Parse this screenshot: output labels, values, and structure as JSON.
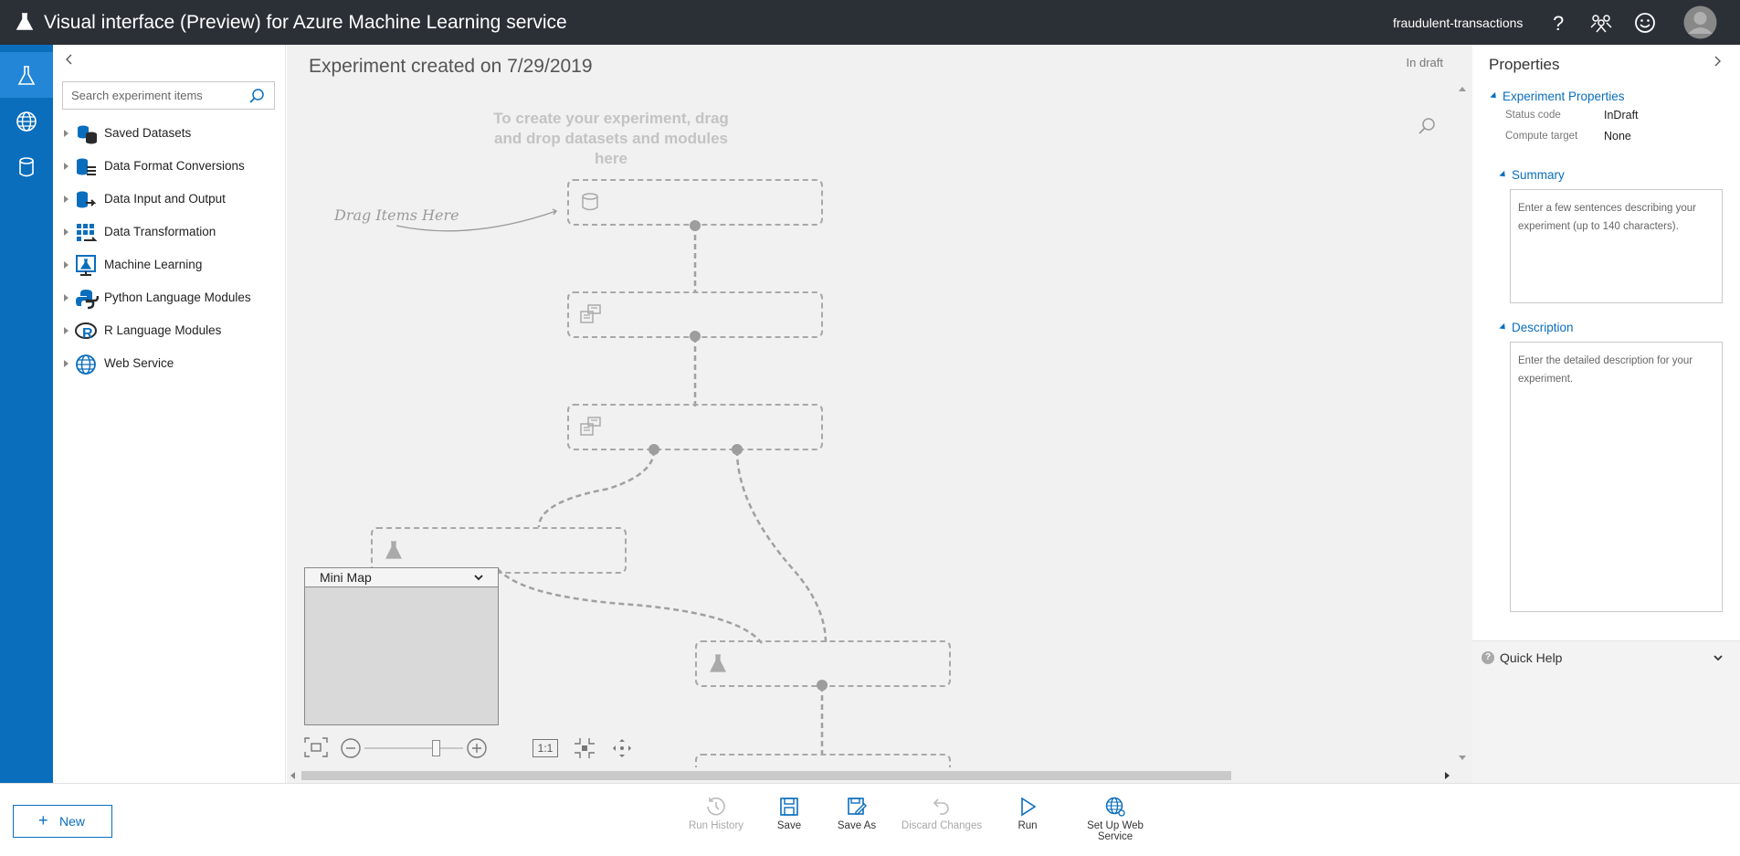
{
  "topbar": {
    "title": "Visual interface (Preview) for Azure Machine Learning service",
    "workspace": "fraudulent-transactions",
    "icons": [
      "flask-logo-icon",
      "help-icon",
      "community-icon",
      "feedback-smiley-icon",
      "user-avatar-icon"
    ]
  },
  "leftnav": {
    "items": [
      {
        "name": "experiments",
        "icon": "flask-icon",
        "active": true
      },
      {
        "name": "web-services",
        "icon": "globe-icon",
        "active": false
      },
      {
        "name": "datasets",
        "icon": "database-icon",
        "active": false
      }
    ]
  },
  "palette": {
    "search_placeholder": "Search experiment items",
    "categories": [
      {
        "label": "Saved Datasets",
        "icon": "dataset-icon"
      },
      {
        "label": "Data Format Conversions",
        "icon": "conversion-icon"
      },
      {
        "label": "Data Input and Output",
        "icon": "io-icon"
      },
      {
        "label": "Data Transformation",
        "icon": "transform-icon"
      },
      {
        "label": "Machine Learning",
        "icon": "ml-icon"
      },
      {
        "label": "Python Language Modules",
        "icon": "python-icon"
      },
      {
        "label": "R Language Modules",
        "icon": "r-icon"
      },
      {
        "label": "Web Service",
        "icon": "globe-icon"
      }
    ]
  },
  "canvas": {
    "experiment_title": "Experiment created on 7/29/2019",
    "status": "In draft",
    "hint": "To create your experiment, drag and drop datasets and modules here",
    "drag_label": "Drag Items Here",
    "minimap_label": "Mini Map",
    "zoom_reset_label": "1:1"
  },
  "properties": {
    "title": "Properties",
    "experiment_properties_label": "Experiment Properties",
    "status_code_label": "Status code",
    "status_code_value": "InDraft",
    "compute_target_label": "Compute target",
    "compute_target_value": "None",
    "summary_label": "Summary",
    "summary_placeholder": "Enter a few sentences describing your experiment (up to 140 characters).",
    "description_label": "Description",
    "description_placeholder": "Enter the detailed description for your experiment.",
    "quick_help_label": "Quick Help"
  },
  "bottombar": {
    "new_label": "New",
    "actions": [
      {
        "label": "Run History",
        "enabled": false,
        "icon": "history-icon"
      },
      {
        "label": "Save",
        "enabled": true,
        "icon": "save-icon"
      },
      {
        "label": "Save As",
        "enabled": true,
        "icon": "save-as-icon"
      },
      {
        "label": "Discard Changes",
        "enabled": false,
        "icon": "undo-icon"
      },
      {
        "label": "Run",
        "enabled": true,
        "icon": "play-icon"
      },
      {
        "label": "Set Up Web Service",
        "enabled": true,
        "icon": "web-service-icon"
      }
    ]
  },
  "colors": {
    "topbar": "#2b2f36",
    "leftnav": "#0a6ebd",
    "accent": "#0a6ebd",
    "canvas": "#f1f1f1"
  }
}
